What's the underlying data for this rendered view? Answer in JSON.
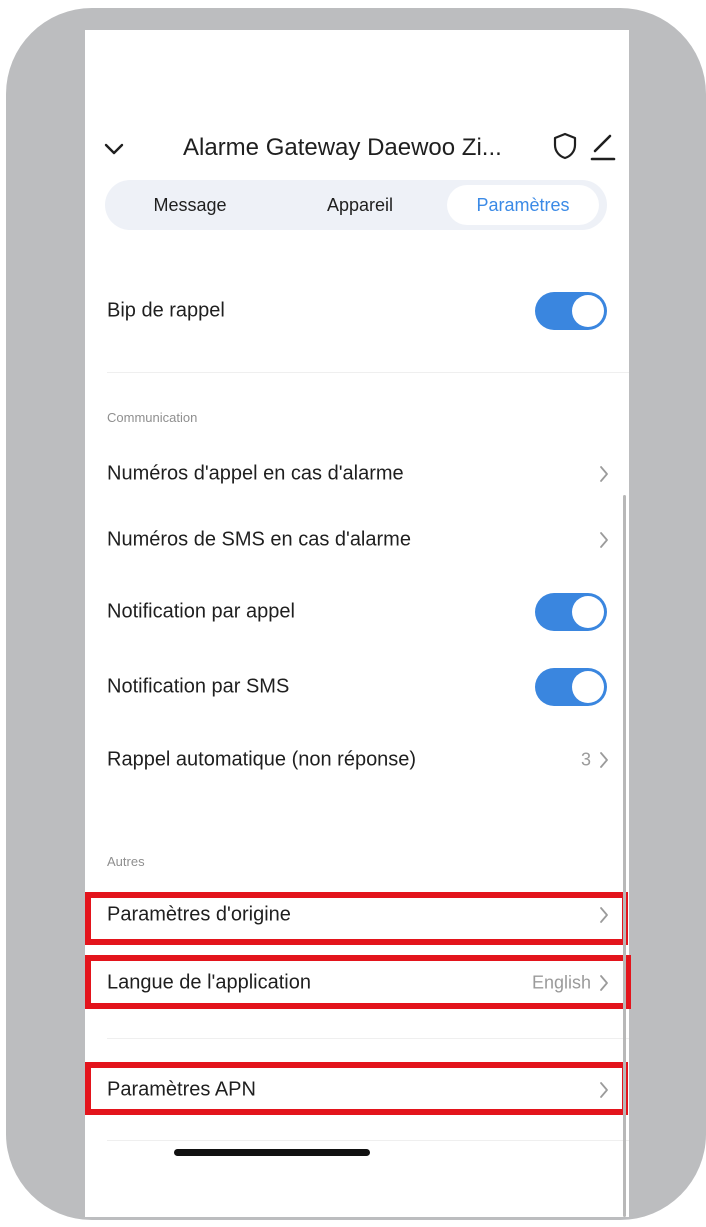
{
  "header": {
    "title": "Alarme Gateway Daewoo Zi..."
  },
  "tabs": [
    {
      "label": "Message",
      "active": false
    },
    {
      "label": "Appareil",
      "active": false
    },
    {
      "label": "Paramètres",
      "active": true
    }
  ],
  "settings": {
    "bip_de_rappel": {
      "label": "Bip de rappel",
      "enabled": true
    }
  },
  "sections": {
    "communication": {
      "title": "Communication",
      "items": [
        {
          "label": "Numéros d'appel en cas d'alarme",
          "kind": "link"
        },
        {
          "label": "Numéros de SMS en cas d'alarme",
          "kind": "link"
        },
        {
          "label": "Notification par appel",
          "kind": "toggle",
          "enabled": true
        },
        {
          "label": "Notification par SMS",
          "kind": "toggle",
          "enabled": true
        },
        {
          "label": "Rappel automatique (non réponse)",
          "kind": "link",
          "value": "3"
        }
      ]
    },
    "autres": {
      "title": "Autres",
      "items": [
        {
          "label": "Paramètres d'origine",
          "kind": "link",
          "highlighted": true
        },
        {
          "label": "Langue de l'application",
          "kind": "link",
          "value": "English",
          "highlighted": true
        }
      ]
    },
    "apn": {
      "items": [
        {
          "label": "Paramètres APN",
          "kind": "link",
          "highlighted": true
        }
      ]
    }
  },
  "colors": {
    "accent": "#3a86df",
    "tab_active_text": "#3b8ae6",
    "highlight": "#e3141c",
    "frame": "#bcbdbf"
  },
  "icons": [
    "chevron-down-icon",
    "shield-icon",
    "edit-icon",
    "chevron-right-icon"
  ]
}
